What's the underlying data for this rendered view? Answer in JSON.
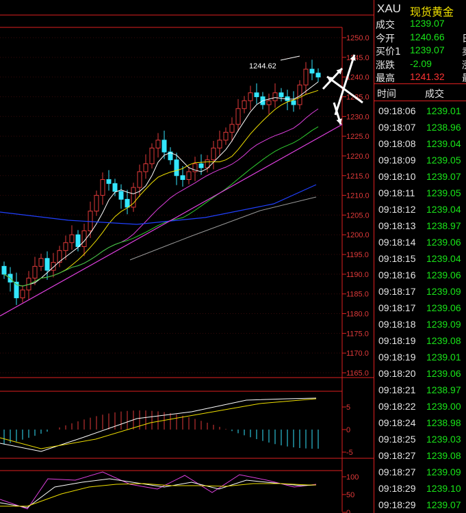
{
  "quote": {
    "symbol": "XAU",
    "name": "现货黄金",
    "rows": [
      {
        "label": "成交",
        "value": "1239.07",
        "color": "green",
        "tail": ""
      },
      {
        "label": "今开",
        "value": "1240.66",
        "color": "green",
        "tail": "日"
      },
      {
        "label": "买价1",
        "value": "1239.07",
        "color": "green",
        "tail": "卖"
      },
      {
        "label": "涨跌",
        "value": "-2.09",
        "color": "green",
        "tail": "涨"
      },
      {
        "label": "最高",
        "value": "1241.32",
        "color": "red",
        "tail": "最"
      }
    ],
    "ticks_header": {
      "time": "时间",
      "price": "成交"
    },
    "ticks": [
      {
        "time": "09:18:06",
        "price": "1239.01"
      },
      {
        "time": "09:18:07",
        "price": "1238.96"
      },
      {
        "time": "09:18:08",
        "price": "1239.04"
      },
      {
        "time": "09:18:09",
        "price": "1239.05"
      },
      {
        "time": "09:18:10",
        "price": "1239.07"
      },
      {
        "time": "09:18:11",
        "price": "1239.05"
      },
      {
        "time": "09:18:12",
        "price": "1239.04"
      },
      {
        "time": "09:18:13",
        "price": "1238.97"
      },
      {
        "time": "09:18:14",
        "price": "1239.06"
      },
      {
        "time": "09:18:15",
        "price": "1239.04"
      },
      {
        "time": "09:18:16",
        "price": "1239.06"
      },
      {
        "time": "09:18:17",
        "price": "1239.09"
      },
      {
        "time": "09:18:17",
        "price": "1239.06"
      },
      {
        "time": "09:18:18",
        "price": "1239.09"
      },
      {
        "time": "09:18:19",
        "price": "1239.08"
      },
      {
        "time": "09:18:19",
        "price": "1239.01"
      },
      {
        "time": "09:18:20",
        "price": "1239.06"
      },
      {
        "time": "09:18:21",
        "price": "1238.97"
      },
      {
        "time": "09:18:22",
        "price": "1239.00"
      },
      {
        "time": "09:18:24",
        "price": "1238.98"
      },
      {
        "time": "09:18:25",
        "price": "1239.03"
      },
      {
        "time": "09:18:27",
        "price": "1239.08"
      },
      {
        "time": "09:18:27",
        "price": "1239.09"
      },
      {
        "time": "09:18:29",
        "price": "1239.10"
      },
      {
        "time": "09:18:29",
        "price": "1239.07"
      }
    ]
  },
  "chart": {
    "price_annotation": "1244.62",
    "price_axis": [
      "1250.0",
      "1245.0",
      "1240.0",
      "1235.0",
      "1230.0",
      "1225.0",
      "1220.0",
      "1215.0",
      "1210.0",
      "1205.0",
      "1200.0",
      "1195.0",
      "1190.0",
      "1185.0",
      "1180.0",
      "1175.0",
      "1170.0",
      "1165.0"
    ],
    "macd_axis": [
      "5",
      "0",
      "-5"
    ],
    "kdj_axis": [
      "100",
      "50",
      "0"
    ],
    "colors": {
      "up": "#e23a3a",
      "down": "#33e6ff",
      "grid": "#e02020"
    }
  }
}
